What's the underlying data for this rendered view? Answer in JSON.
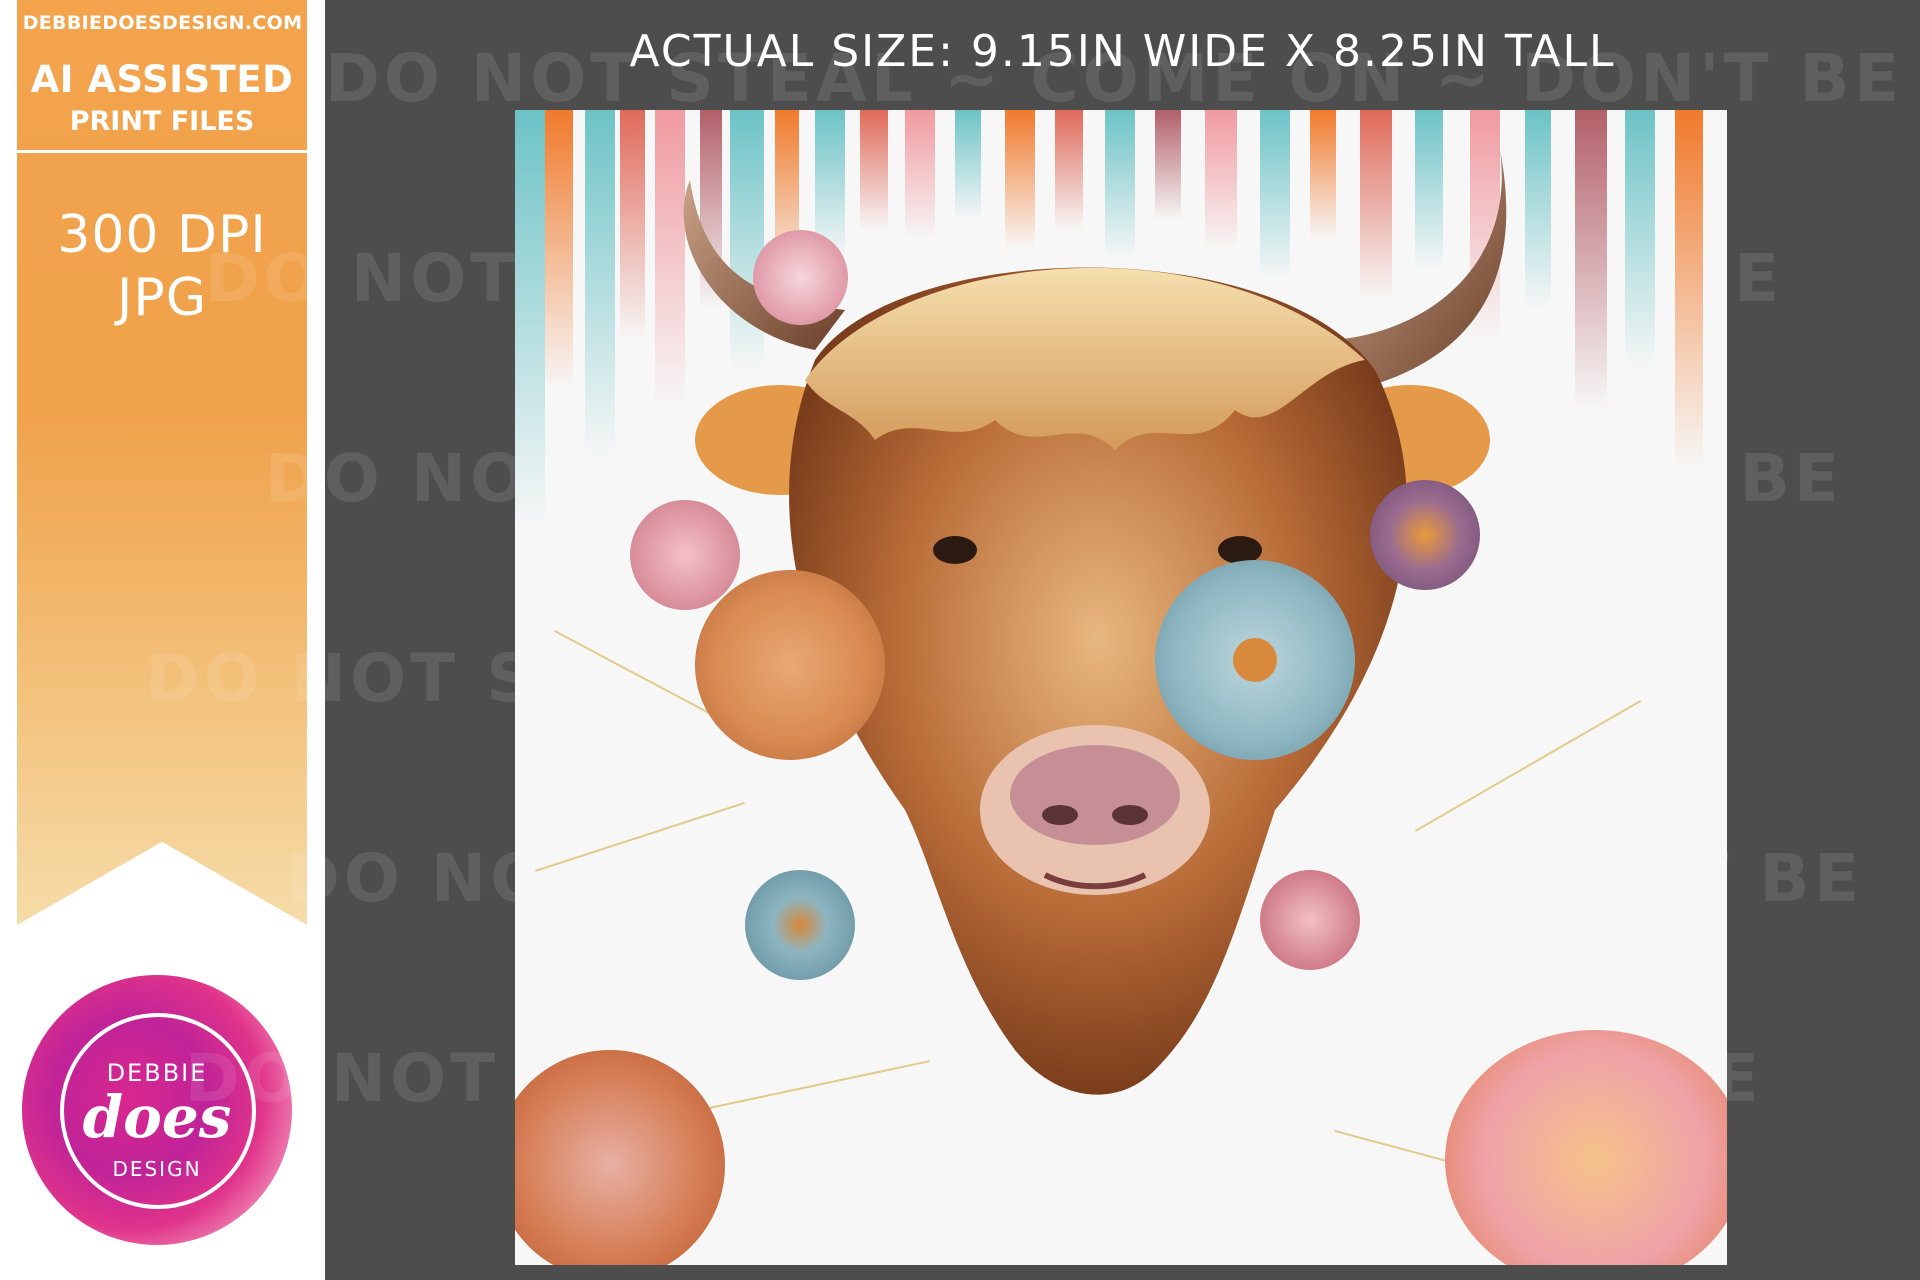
{
  "promo": {
    "site_url": "DEBBIEDOESDESIGN.COM",
    "badge_line1": "AI ASSISTED",
    "badge_line2": "PRINT FILES",
    "resolution": "300 DPI",
    "format": "JPG"
  },
  "logo": {
    "top_text": "DEBBIE",
    "middle_text": "does",
    "bottom_text": "DESIGN"
  },
  "header": {
    "size_text": "ACTUAL SIZE: 9.15IN WIDE X 8.25IN TALL"
  },
  "watermark": {
    "text": "DO NOT STEAL ~ COME ON ~ DON'T BE THAT GUY ~ DO NOT STEAL ~ COME ON ~ DON'T BE THAT GUY ~"
  },
  "colors": {
    "frame": "#4d4d4d",
    "banner": "#f2a34c",
    "logo": "#d9278f",
    "accent_teal": "#6cc3c6",
    "accent_orange": "#f07a2c"
  },
  "artwork": {
    "subject": "highland-cow-with-flowers"
  }
}
